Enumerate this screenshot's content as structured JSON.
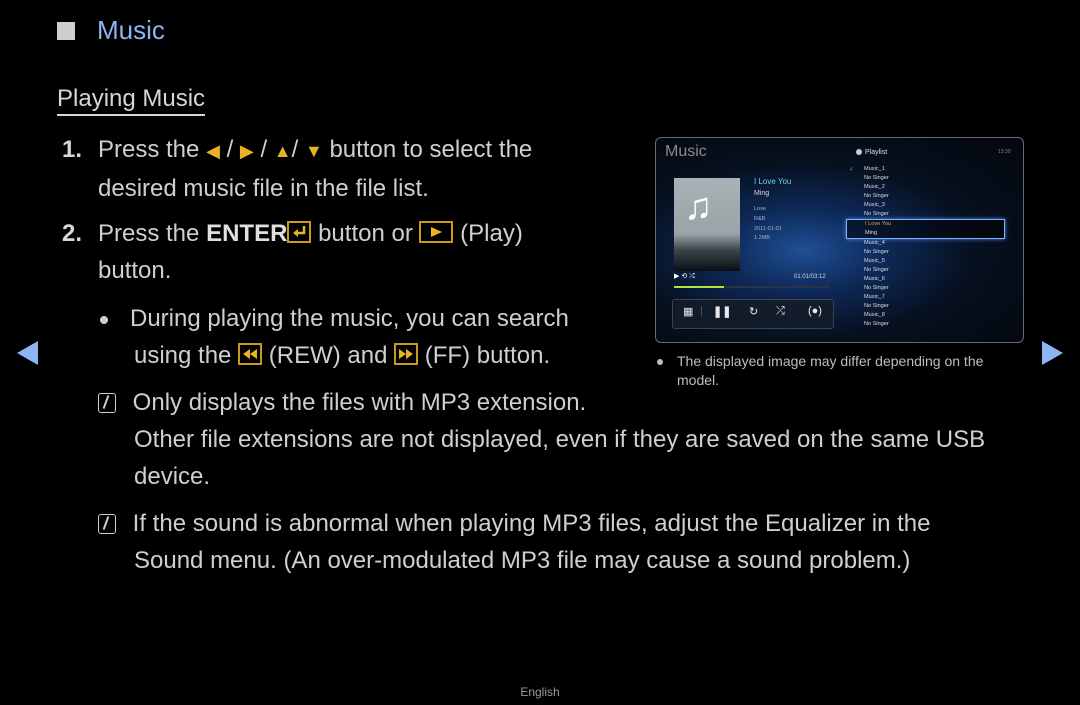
{
  "section": {
    "title": "Music",
    "bullet_icon": "square-bullet-icon"
  },
  "subsection": {
    "title": "Playing Music"
  },
  "steps": [
    {
      "number": "1.",
      "text_before": "Press the",
      "arrows": [
        "◀",
        "▶",
        "▲",
        "▼"
      ],
      "separator": "/",
      "text_after": "button to select the",
      "line2": "desired music file in the file list."
    },
    {
      "number": "2.",
      "text_before": "Press the",
      "enter_label": "ENTER",
      "text_mid": "button or",
      "play_label": "(Play)",
      "line2": "button."
    }
  ],
  "bullet": {
    "line1": "During playing the music, you can search",
    "line2_before": "using the",
    "rew_label": "(REW) and",
    "ff_label": "(FF) button."
  },
  "notes": [
    {
      "line1": "Only displays the files with MP3 extension.",
      "line2": "Other file extensions are not displayed, even if they are saved on the same USB",
      "line3": "device."
    },
    {
      "line1": "If the sound is abnormal when playing MP3 files, adjust the Equalizer in the",
      "line2": "Sound menu. (An over-modulated MP3 file may cause a sound problem.)"
    }
  ],
  "caption": {
    "line1": "The displayed image may differ depending on the",
    "line2": "model."
  },
  "player": {
    "title": "Music",
    "clock": "13:30",
    "now_playing": {
      "song": "I Love You",
      "artist": "Ming",
      "album": "Love",
      "genre": "R&B",
      "date": "2011-01-01",
      "size": "1.2MB"
    },
    "status_icons": "▶ ⟲ ⤮",
    "time": "01:01/03:12",
    "progress_fraction": 0.32,
    "controls": [
      "grid-menu",
      "pause",
      "repeat",
      "shuffle",
      "sound-mode"
    ],
    "playlist_label": "Playlist",
    "playlist": [
      {
        "title": "Music_1",
        "artist": "No Singer",
        "checked": true
      },
      {
        "title": "Music_2",
        "artist": "No Singer"
      },
      {
        "title": "Music_3",
        "artist": "No Singer"
      },
      {
        "title": "I Love You",
        "artist": "Ming",
        "selected": true
      },
      {
        "title": "Music_4",
        "artist": "No Singer"
      },
      {
        "title": "Music_5",
        "artist": "No Singer"
      },
      {
        "title": "Music_6",
        "artist": "No Singer"
      },
      {
        "title": "Music_7",
        "artist": "No Singer"
      },
      {
        "title": "Music_8",
        "artist": "No Singer"
      }
    ]
  },
  "footer": {
    "language": "English"
  },
  "colors": {
    "accent": "#8fb4f4",
    "key_yellow": "#e8b423",
    "text": "#cfcfcf",
    "progress": "#b8e23a"
  }
}
